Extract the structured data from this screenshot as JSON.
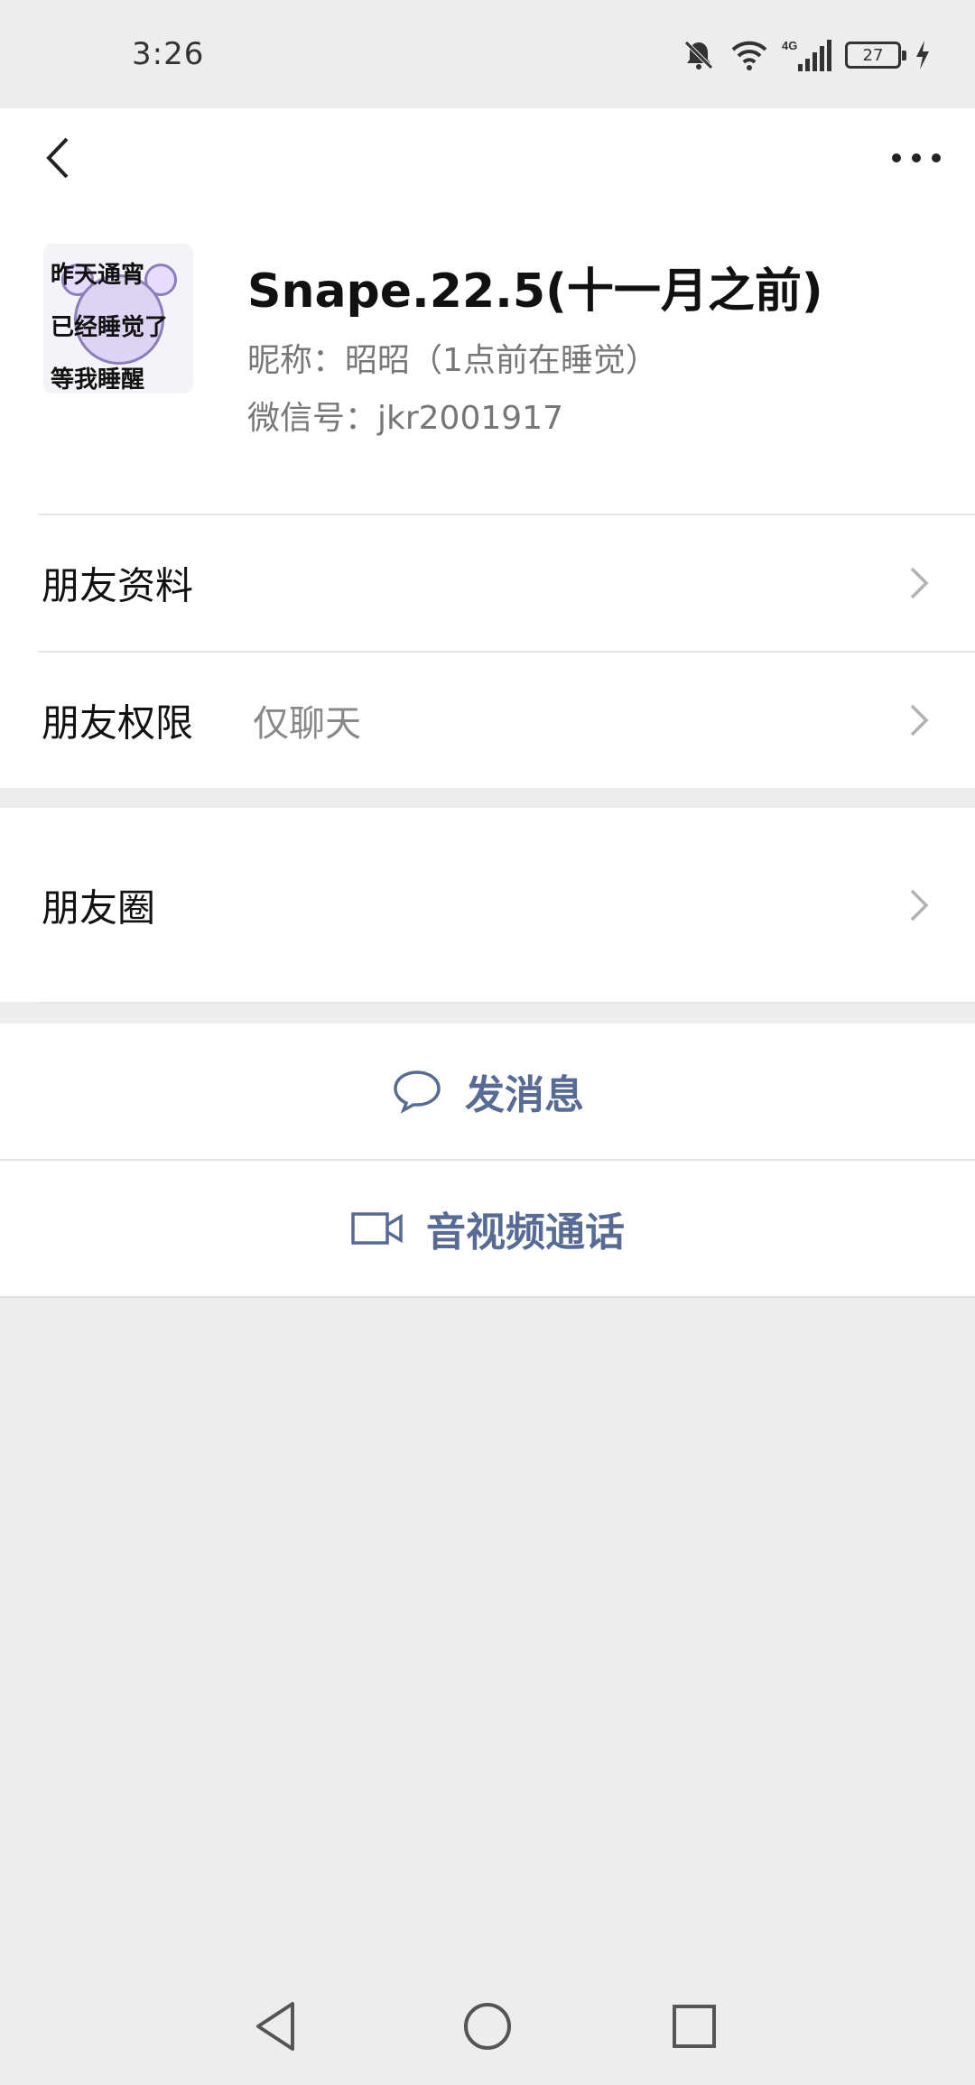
{
  "status_bar": {
    "time": "3:26",
    "battery": "27",
    "network": "4G",
    "icons": [
      "mute-bell-icon",
      "wifi-icon",
      "signal-icon",
      "battery-icon",
      "charging-icon"
    ]
  },
  "nav": {
    "back_icon": "chevron-left-icon",
    "more_icon": "more-dots-icon"
  },
  "profile": {
    "display_name": "Snape.22.5(十一月之前)",
    "nickname": "昵称：昭昭（1点前在睡觉）",
    "wechat_id": "微信号：jkr2001917",
    "avatar_lines": [
      "昨天通宵",
      "已经睡觉了",
      "等我睡醒"
    ]
  },
  "rows": {
    "friend_profile": {
      "label": "朋友资料"
    },
    "friend_permissions": {
      "label": "朋友权限",
      "value": "仅聊天"
    },
    "moments": {
      "label": "朋友圈"
    }
  },
  "actions": {
    "send_message": "发消息",
    "video_call": "音视频通话"
  },
  "colors": {
    "background": "#ededed",
    "card": "#ffffff",
    "link_blue": "#576b95",
    "secondary_text": "#888888"
  }
}
